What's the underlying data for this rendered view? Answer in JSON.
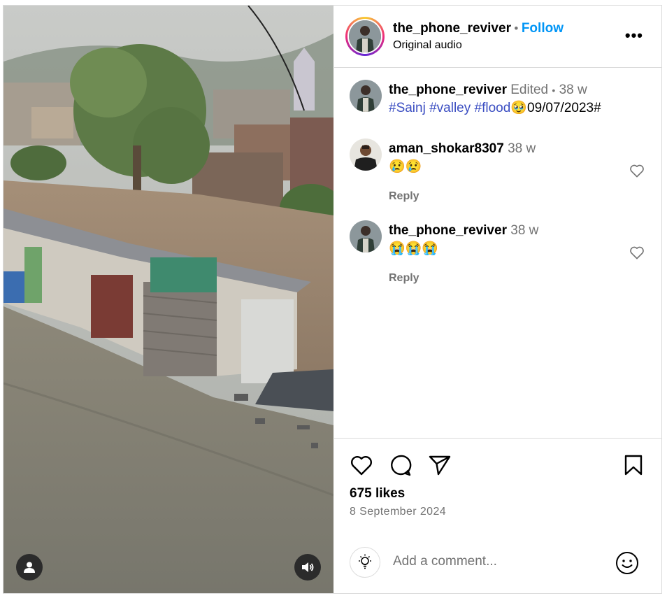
{
  "header": {
    "username": "the_phone_reviver",
    "separator": "•",
    "follow_label": "Follow",
    "audio_label": "Original audio",
    "more_label": "•••"
  },
  "caption": {
    "username": "the_phone_reviver",
    "edited": "Edited",
    "dot": "•",
    "time": "38 w",
    "tags": [
      "#Sainj",
      "#valley",
      "#flood"
    ],
    "emoji": "🥹",
    "tail": "09/07/2023#"
  },
  "comments": [
    {
      "username": "aman_shokar8307",
      "time": "38 w",
      "text": "😢😢",
      "reply_label": "Reply"
    },
    {
      "username": "the_phone_reviver",
      "time": "38 w",
      "text": "😭😭😭",
      "reply_label": "Reply"
    }
  ],
  "post": {
    "likes": "675 likes",
    "date": "8 September 2024"
  },
  "add_comment": {
    "placeholder": "Add a comment..."
  },
  "icons": {
    "like": "heart-icon",
    "comment": "comment-bubble-icon",
    "share": "paper-plane-icon",
    "save": "bookmark-icon",
    "tagged_user": "user-icon",
    "sound": "speaker-icon",
    "idea": "lightbulb-icon",
    "emoji": "smiley-icon"
  },
  "colors": {
    "follow": "#0095f6",
    "hashtag": "#3b4ec2",
    "muted": "#737373",
    "border": "#dbdbdb"
  }
}
